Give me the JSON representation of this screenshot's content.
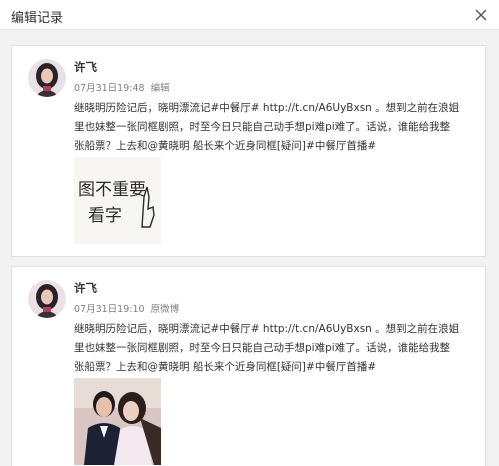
{
  "dialog": {
    "title": "编辑记录",
    "close_icon": "close-icon"
  },
  "records": [
    {
      "username": "许飞",
      "timestamp": "07月31日19:48",
      "action": "编辑",
      "text_lines": [
        "继晓明历险记后，晓明漂流记#中餐厅# http://t.cn/A6UyBxsn 。想到之前在浪姐",
        "里也妹整一张同框剧照，时至今日只能自己动手想pi难pi难了。话说，谁能给我整",
        "张船票？上去和@黄晓明 船长来个近身同框[疑问]#中餐厅首播#"
      ],
      "image_description_icon": "handwriting-image",
      "image_text": [
        "图不重要",
        "看字"
      ]
    },
    {
      "username": "许飞",
      "timestamp": "07月31日19:10",
      "action": "原微博",
      "text_lines": [
        "继晓明历险记后，晓明漂流记#中餐厅# http://t.cn/A6UyBxsn 。想到之前在浪姐",
        "里也妹整一张同框剧照，时至今日只能自己动手想pi难pi难了。话说，谁能给我整",
        "张船票？上去和@黄晓明 船长来个近身同框[疑问]#中餐厅首播#"
      ],
      "image_description_icon": "photo-image"
    }
  ],
  "colors": {
    "background": "#f2f2f2",
    "card": "#ffffff",
    "text": "#333333",
    "meta": "#808080"
  }
}
